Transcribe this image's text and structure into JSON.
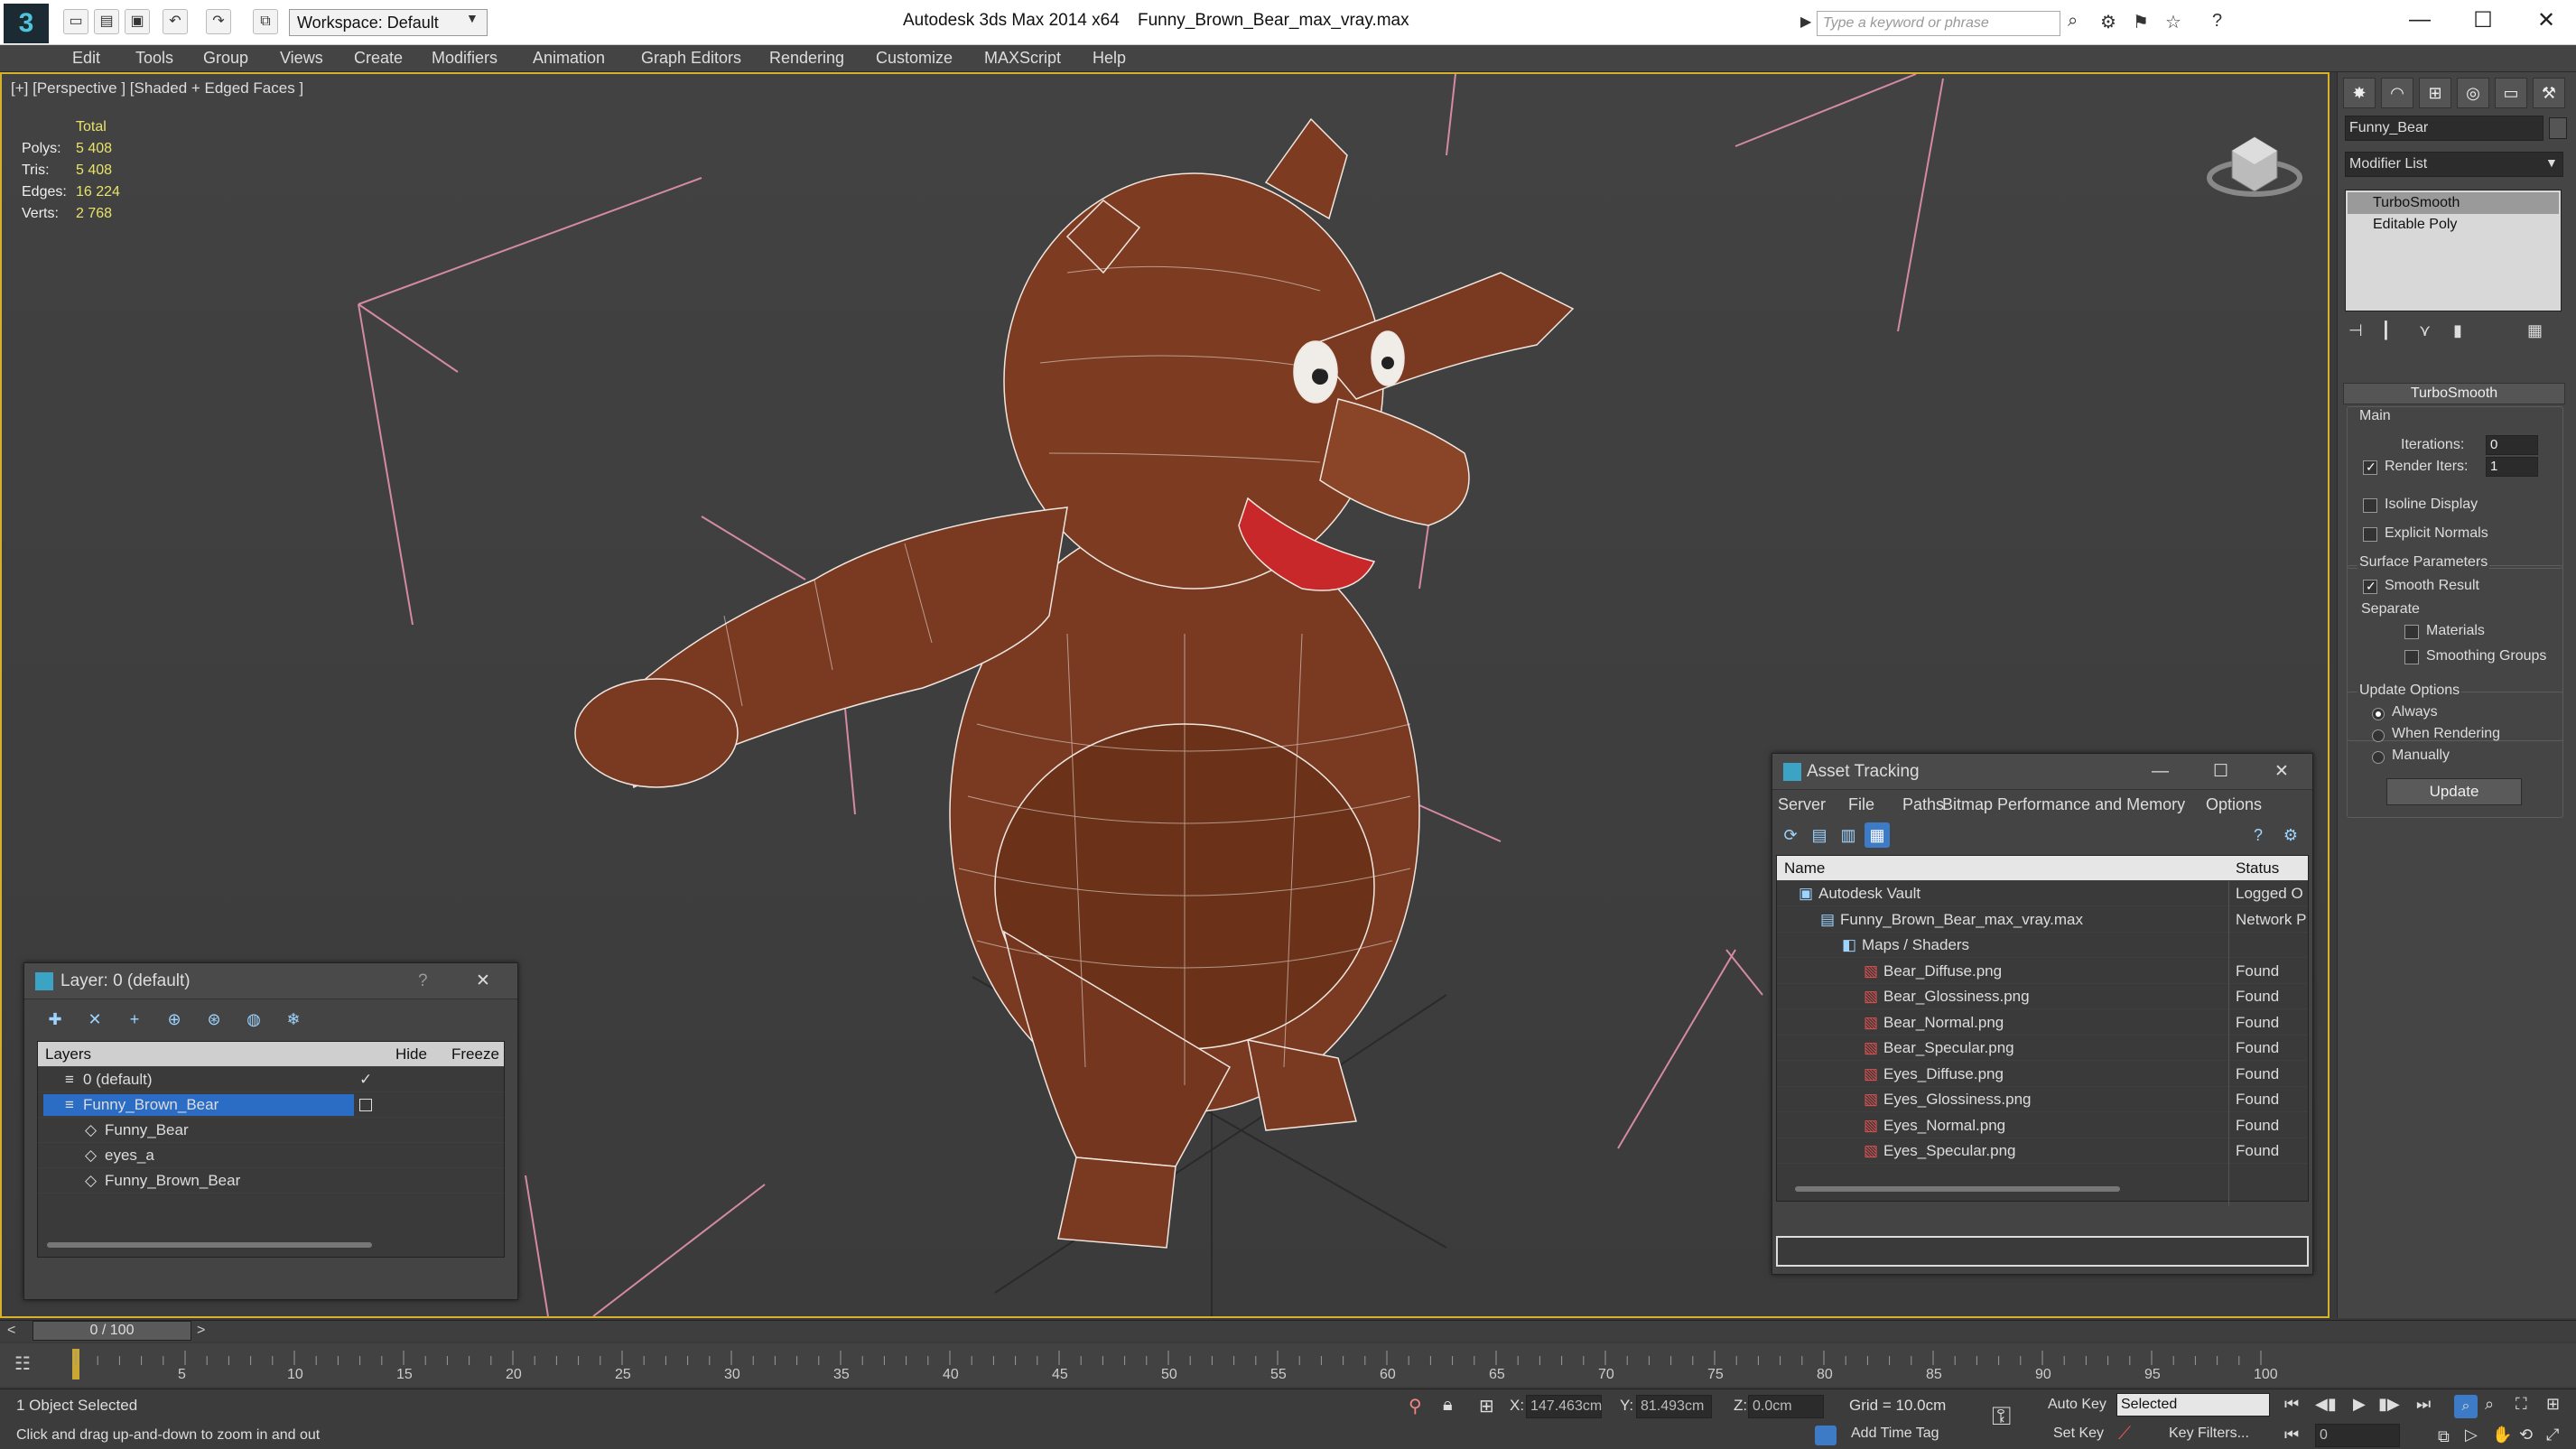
{
  "titlebar": {
    "logo": "3",
    "workspace": "Workspace: Default",
    "app_title": "Autodesk 3ds Max  2014 x64",
    "file_title": "Funny_Brown_Bear_max_vray.max",
    "search_placeholder": "Type a keyword or phrase",
    "minimize": "—",
    "maximize": "☐",
    "close": "✕"
  },
  "menu": [
    "Edit",
    "Tools",
    "Group",
    "Views",
    "Create",
    "Modifiers",
    "Animation",
    "Graph Editors",
    "Rendering",
    "Customize",
    "MAXScript",
    "Help"
  ],
  "viewport": {
    "label": "[+] [Perspective ] [Shaded + Edged Faces ]",
    "stats_header": "Total",
    "stats": [
      {
        "label": "Polys:",
        "value": "5 408"
      },
      {
        "label": "Tris:",
        "value": "5 408"
      },
      {
        "label": "Edges:",
        "value": "16 224"
      },
      {
        "label": "Verts:",
        "value": "2 768"
      }
    ]
  },
  "command_panel": {
    "object_name": "Funny_Bear",
    "modifier_list": "Modifier List",
    "stack": [
      "TurboSmooth",
      "Editable Poly"
    ],
    "rollout_title": "TurboSmooth",
    "main_label": "Main",
    "iterations_label": "Iterations:",
    "iterations_value": "0",
    "render_iters_label": "Render Iters:",
    "render_iters_value": "1",
    "isoline": "Isoline Display",
    "explicit_normals": "Explicit Normals",
    "surface_params": "Surface Parameters",
    "smooth_result": "Smooth Result",
    "separate": "Separate",
    "materials": "Materials",
    "smoothing_groups": "Smoothing Groups",
    "update_options": "Update Options",
    "always": "Always",
    "when_rendering": "When Rendering",
    "manually": "Manually",
    "update_button": "Update"
  },
  "layer_dialog": {
    "title": "Layer: 0 (default)",
    "help": "?",
    "close": "✕",
    "col_layers": "Layers",
    "col_hide": "Hide",
    "col_freeze": "Freeze",
    "rows": [
      {
        "name": "0 (default)",
        "indent": 0
      },
      {
        "name": "Funny_Brown_Bear",
        "indent": 0
      },
      {
        "name": "Funny_Bear",
        "indent": 1
      },
      {
        "name": "eyes_a",
        "indent": 1
      },
      {
        "name": "Funny_Brown_Bear",
        "indent": 1
      }
    ]
  },
  "asset_dialog": {
    "title": "Asset Tracking",
    "menu": [
      "Server",
      "File",
      "Paths",
      "Bitmap Performance and Memory",
      "Options"
    ],
    "col_name": "Name",
    "col_status": "Status",
    "rows": [
      {
        "name": "Autodesk Vault",
        "status": "Logged O",
        "indent": 1
      },
      {
        "name": "Funny_Brown_Bear_max_vray.max",
        "status": "Network P",
        "indent": 2
      },
      {
        "name": "Maps / Shaders",
        "status": "",
        "indent": 3
      },
      {
        "name": "Bear_Diffuse.png",
        "status": "Found",
        "indent": 4
      },
      {
        "name": "Bear_Glossiness.png",
        "status": "Found",
        "indent": 4
      },
      {
        "name": "Bear_Normal.png",
        "status": "Found",
        "indent": 4
      },
      {
        "name": "Bear_Specular.png",
        "status": "Found",
        "indent": 4
      },
      {
        "name": "Eyes_Diffuse.png",
        "status": "Found",
        "indent": 4
      },
      {
        "name": "Eyes_Glossiness.png",
        "status": "Found",
        "indent": 4
      },
      {
        "name": "Eyes_Normal.png",
        "status": "Found",
        "indent": 4
      },
      {
        "name": "Eyes_Specular.png",
        "status": "Found",
        "indent": 4
      }
    ]
  },
  "timeline": {
    "frame": "0 / 100",
    "ticks": [
      "5",
      "10",
      "15",
      "20",
      "25",
      "30",
      "35",
      "40",
      "45",
      "50",
      "55",
      "60",
      "65",
      "70",
      "75",
      "80",
      "85",
      "90",
      "95",
      "100"
    ]
  },
  "status": {
    "selected": "1 Object Selected",
    "prompt": "Click and drag up-and-down to zoom in and out",
    "x_label": "X:",
    "x_value": "147.463cm",
    "y_label": "Y:",
    "y_value": "81.493cm",
    "z_label": "Z:",
    "z_value": "0.0cm",
    "grid": "Grid = 10.0cm",
    "add_time_tag": "Add Time Tag",
    "auto_key": "Auto Key",
    "set_key": "Set Key",
    "selected_dropdown": "Selected",
    "key_filters": "Key Filters...",
    "frame_value": "0"
  }
}
